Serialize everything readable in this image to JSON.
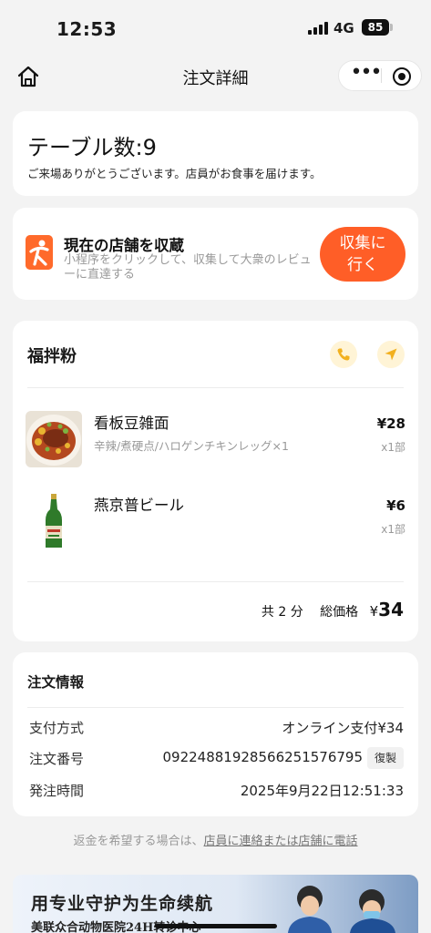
{
  "status_bar": {
    "time": "12:53",
    "network": "4G",
    "battery": "85"
  },
  "nav": {
    "title": "注文詳細"
  },
  "table": {
    "title": "テーブル数:9",
    "subtitle": "ご来場ありがとうございます。店員がお食事を届けます。"
  },
  "collect": {
    "title": "現在の店舗を収蔵",
    "description": "小程序をクリックして、収集して大衆のレビューに直達する",
    "button_line1": "収集に",
    "button_line2": "行く",
    "brand_color": "#ff5e27"
  },
  "shop": {
    "name": "福拌粉",
    "items": [
      {
        "name": "看板豆雑面",
        "spec": "辛辣/煮硬点/ハロゲンチキンレッグ×1",
        "price": "¥28",
        "qty": "x1部"
      },
      {
        "name": "燕京普ビール",
        "spec": "",
        "price": "¥6",
        "qty": "x1部"
      }
    ],
    "total_count": "共 2 分",
    "total_label": "総価格",
    "total_symbol": "¥",
    "total_amount": "34"
  },
  "order_info": {
    "title": "注文情報",
    "payment_label": "支付方式",
    "payment_value": "オンライン支付¥34",
    "order_no_label": "注文番号",
    "order_no_value": "0922488192856625157679​5",
    "copy_label": "復製",
    "order_time_label": "発注時間",
    "order_time_value": "2025年9月22日12:51:33"
  },
  "refund": {
    "text": "返金を希望する場合は、",
    "link": "店員に連絡または店舗に電話"
  },
  "banner": {
    "title": "用专业守护为生命续航",
    "subtitle": "美联众合动物医院24H转诊中心"
  }
}
